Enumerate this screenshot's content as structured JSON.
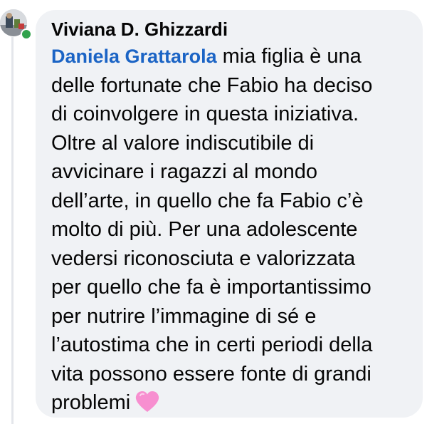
{
  "comment": {
    "author_name": "Viviana D. Ghizzardi",
    "mention": "Daniela Grattarola",
    "lines": [
      " mia figlia è una",
      "delle fortunate che Fabio ha deciso",
      "di coinvolgere in questa iniziativa.",
      "Oltre al valore indiscutibile di",
      "avvicinare i ragazzi al mondo",
      "dell’arte, in quello che fa Fabio c’è",
      "molto di più. Per una adolescente",
      "vedersi riconosciuta e valorizzata",
      "per quello che fa è importantissimo",
      "per nutrire l’immagine di sé e",
      "l’autostima che in certi periodi della",
      "vita possono essere fonte di grandi",
      "problemi"
    ],
    "emoji": "pink-heart-icon"
  },
  "colors": {
    "bubble_bg": "#f0f2f5",
    "mention": "#1b64c5",
    "online": "#31a24c",
    "heart": "#f78fd0"
  }
}
